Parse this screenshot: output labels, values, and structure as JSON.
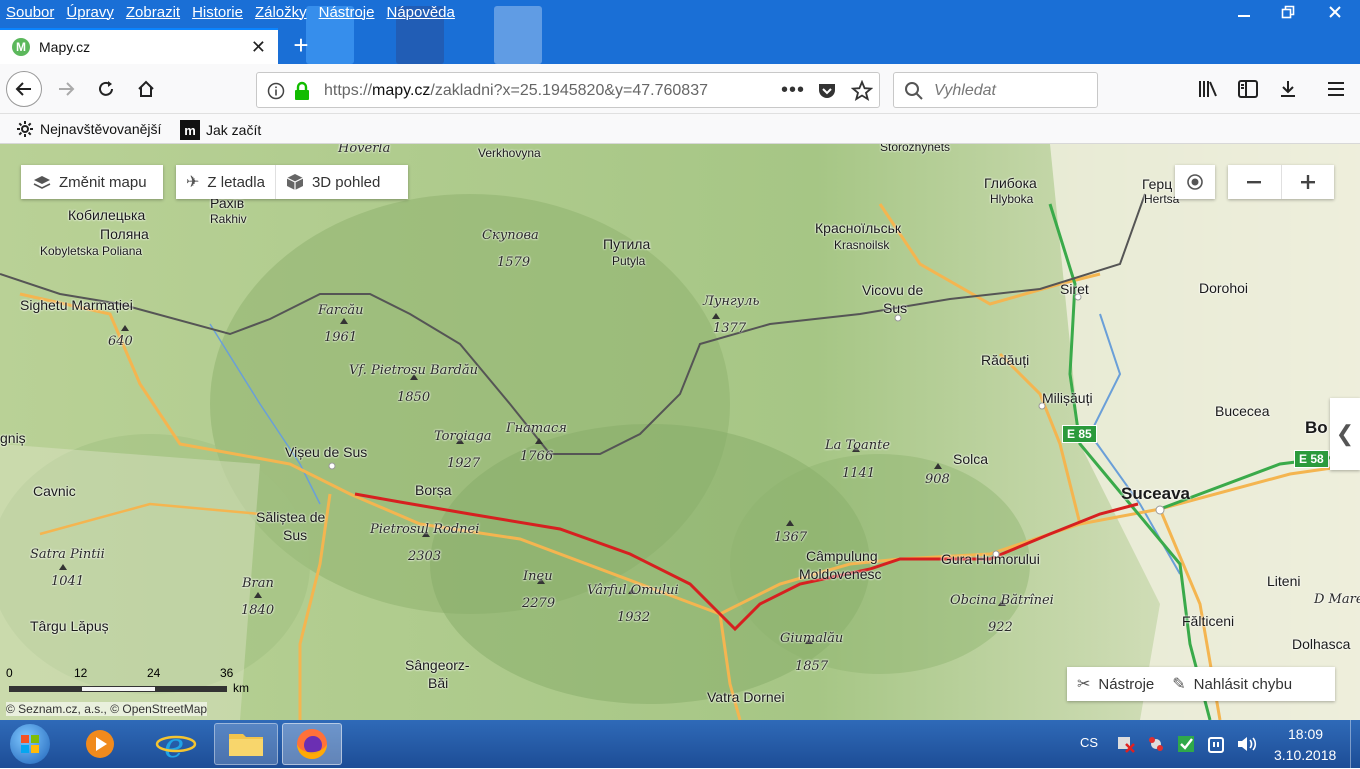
{
  "menu": [
    "Soubor",
    "Úpravy",
    "Zobrazit",
    "Historie",
    "Záložky",
    "Nástroje",
    "Nápověda"
  ],
  "tab": {
    "title": "Mapy.cz",
    "favicon": "M"
  },
  "url": {
    "scheme": "https://",
    "host": "mapy.cz",
    "path": "/zakladni?x=25.1945820&y=47.760837"
  },
  "search": {
    "placeholder": "Vyhledat"
  },
  "bookmarks": [
    "Nejnavštěvovanější",
    "Jak začít"
  ],
  "map_controls": {
    "change_map": "Změnit mapu",
    "from_plane": "Z letadla",
    "view_3d": "3D pohled",
    "tools": "Nástroje",
    "report": "Nahlásit chybu"
  },
  "scale": {
    "ticks": [
      "0",
      "12",
      "24",
      "36"
    ],
    "unit": "km"
  },
  "copyright": "© Seznam.cz, a.s., © OpenStreetMap",
  "roads": [
    "E 85",
    "E 58"
  ],
  "places": [
    {
      "t": "Hoverla",
      "k": "peak"
    },
    {
      "t": "Verkhovyna",
      "k": "place"
    },
    {
      "t": "Storozhynets",
      "k": "place"
    },
    {
      "t": "Кобилецька",
      "k": "place"
    },
    {
      "t": "Поляна",
      "k": "place"
    },
    {
      "t": "Kobyletska Poliana",
      "k": "sub"
    },
    {
      "t": "Рахів",
      "k": "place"
    },
    {
      "t": "Rakhiv",
      "k": "sub"
    },
    {
      "t": "Скупова",
      "k": "peak"
    },
    {
      "t": "1579",
      "k": "peak"
    },
    {
      "t": "Путила",
      "k": "place"
    },
    {
      "t": "Putyla",
      "k": "sub"
    },
    {
      "t": "Красноїльськ",
      "k": "place"
    },
    {
      "t": "Krasnoilsk",
      "k": "sub"
    },
    {
      "t": "Глибока",
      "k": "place"
    },
    {
      "t": "Hlyboka",
      "k": "sub"
    },
    {
      "t": "Герц",
      "k": "place"
    },
    {
      "t": "Hertsa",
      "k": "sub"
    },
    {
      "t": "Sighetu Marmației",
      "k": "place"
    },
    {
      "t": "640",
      "k": "peak"
    },
    {
      "t": "Farcău",
      "k": "peak"
    },
    {
      "t": "1961",
      "k": "peak"
    },
    {
      "t": "Лунгуль",
      "k": "peak"
    },
    {
      "t": "1377",
      "k": "peak"
    },
    {
      "t": "Vicovu de",
      "k": "place"
    },
    {
      "t": "Sus",
      "k": "place"
    },
    {
      "t": "Siret",
      "k": "place"
    },
    {
      "t": "Dorohoi",
      "k": "place"
    },
    {
      "t": "Vf. Pietrosu Bardău",
      "k": "peak"
    },
    {
      "t": "1850",
      "k": "peak"
    },
    {
      "t": "Rădăuți",
      "k": "place"
    },
    {
      "t": "Milișăuți",
      "k": "place"
    },
    {
      "t": "Bucecea",
      "k": "place"
    },
    {
      "t": "gniș",
      "k": "place"
    },
    {
      "t": "Toroiaga",
      "k": "peak"
    },
    {
      "t": "1927",
      "k": "peak"
    },
    {
      "t": "Гнатася",
      "k": "peak"
    },
    {
      "t": "1766",
      "k": "peak"
    },
    {
      "t": "La Toante",
      "k": "peak"
    },
    {
      "t": "1141",
      "k": "peak"
    },
    {
      "t": "Vișeu de Sus",
      "k": "place"
    },
    {
      "t": "Solca",
      "k": "place"
    },
    {
      "t": "908",
      "k": "peak"
    },
    {
      "t": "Bo",
      "k": "big"
    },
    {
      "t": "Cavnic",
      "k": "place"
    },
    {
      "t": "Borșa",
      "k": "place"
    },
    {
      "t": "Suceava",
      "k": "big"
    },
    {
      "t": "Săliștea de",
      "k": "place"
    },
    {
      "t": "Sus",
      "k": "place"
    },
    {
      "t": "Pietrosul Rodnei",
      "k": "peak"
    },
    {
      "t": "2303",
      "k": "peak"
    },
    {
      "t": "1367",
      "k": "peak"
    },
    {
      "t": "Câmpulung",
      "k": "place"
    },
    {
      "t": "Moldovenesc",
      "k": "place"
    },
    {
      "t": "Gura Humorului",
      "k": "place"
    },
    {
      "t": "Satra Pintii",
      "k": "peak"
    },
    {
      "t": "1041",
      "k": "peak"
    },
    {
      "t": "Ineu",
      "k": "peak"
    },
    {
      "t": "2279",
      "k": "peak"
    },
    {
      "t": "Vârful Omului",
      "k": "peak"
    },
    {
      "t": "1932",
      "k": "peak"
    },
    {
      "t": "Obcina Bătrînei",
      "k": "peak"
    },
    {
      "t": "922",
      "k": "peak"
    },
    {
      "t": "Liteni",
      "k": "place"
    },
    {
      "t": "Bran",
      "k": "peak"
    },
    {
      "t": "1840",
      "k": "peak"
    },
    {
      "t": "Fălticeni",
      "k": "place"
    },
    {
      "t": "D Mare",
      "k": "peak"
    },
    {
      "t": "Târgu Lăpuș",
      "k": "place"
    },
    {
      "t": "Giumalău",
      "k": "peak"
    },
    {
      "t": "1857",
      "k": "peak"
    },
    {
      "t": "Dolhasca",
      "k": "place"
    },
    {
      "t": "Sângeorz-",
      "k": "place"
    },
    {
      "t": "Băi",
      "k": "place"
    },
    {
      "t": "Vatra Dornei",
      "k": "place"
    }
  ],
  "tray": {
    "lang": "CS",
    "time": "18:09",
    "date": "3.10.2018"
  },
  "colors": {
    "accent": "#0a84ff",
    "route": "#d62020",
    "titlebar": "#1a6fd6",
    "taskbar": "#1d4d96"
  }
}
